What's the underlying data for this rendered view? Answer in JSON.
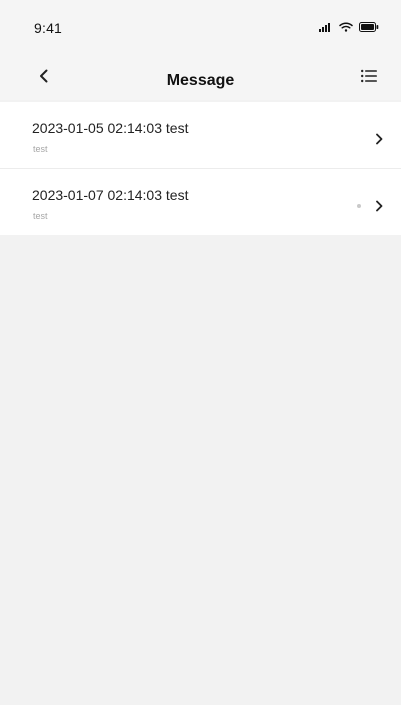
{
  "status_bar": {
    "time": "9:41",
    "icons": [
      "signal-icon",
      "wifi-icon",
      "battery-icon"
    ]
  },
  "header": {
    "title": "Message",
    "back_icon": "chevron-left-icon",
    "menu_icon": "list-menu-icon"
  },
  "messages": [
    {
      "title": "2023-01-05  02:14:03  test",
      "subtitle": "test",
      "unread": false
    },
    {
      "title": "2023-01-07  02:14:03 test",
      "subtitle": "test",
      "unread": true
    }
  ],
  "colors": {
    "page_bg": "#f2f2f2",
    "row_bg": "#ffffff",
    "title_text": "#111111",
    "subtitle_text": "#a6a6a6",
    "dot": "#c9c9c9"
  }
}
